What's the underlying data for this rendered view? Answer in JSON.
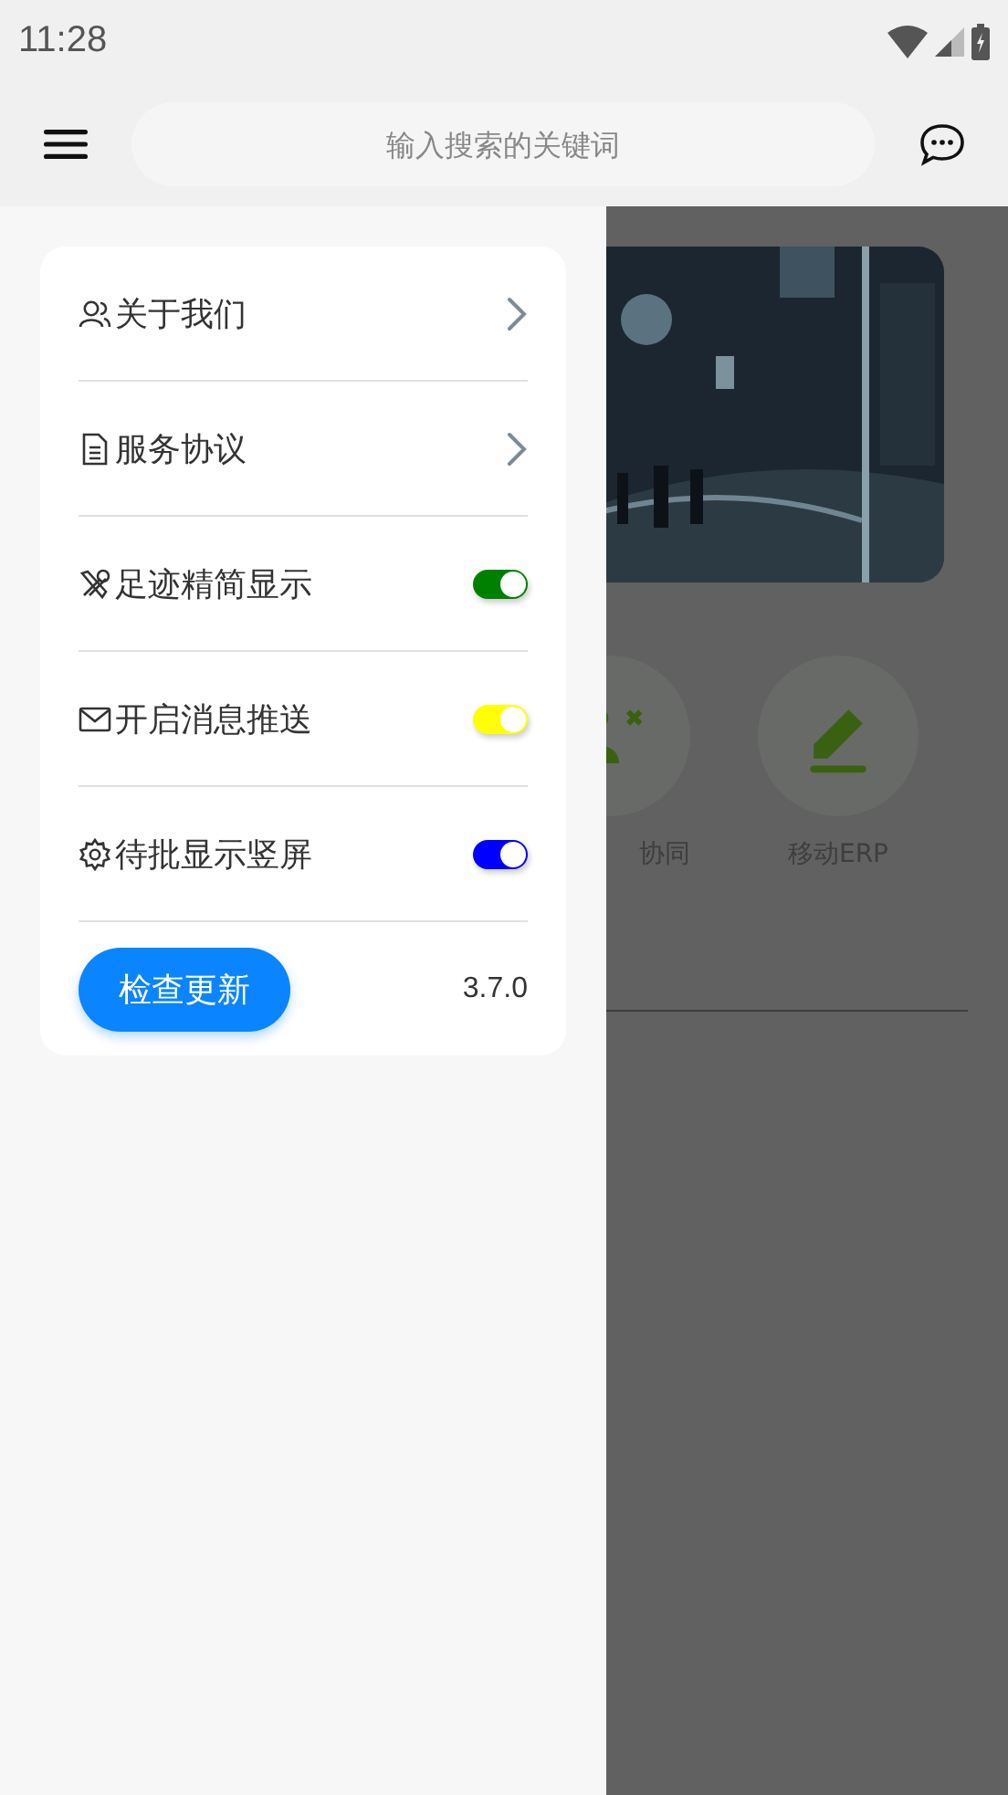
{
  "status_bar": {
    "time": "11:28"
  },
  "app_bar": {
    "search": {
      "placeholder": "输入搜索的关键词"
    }
  },
  "drawer": {
    "items": [
      {
        "kind": "link",
        "label": "关于我们"
      },
      {
        "kind": "link",
        "label": "服务协议"
      },
      {
        "kind": "toggle",
        "label": "足迹精简显示",
        "on": true,
        "color": "#008000"
      },
      {
        "kind": "toggle",
        "label": "开启消息推送",
        "on": true,
        "color": "#ffff00"
      },
      {
        "kind": "toggle",
        "label": "待批显示竖屏",
        "on": true,
        "color": "#0000ff"
      }
    ],
    "update_button": "检查更新",
    "version": "3.7.0"
  },
  "background": {
    "shortcuts": [
      {
        "label": "协同"
      },
      {
        "label": "移动ERP"
      }
    ]
  }
}
